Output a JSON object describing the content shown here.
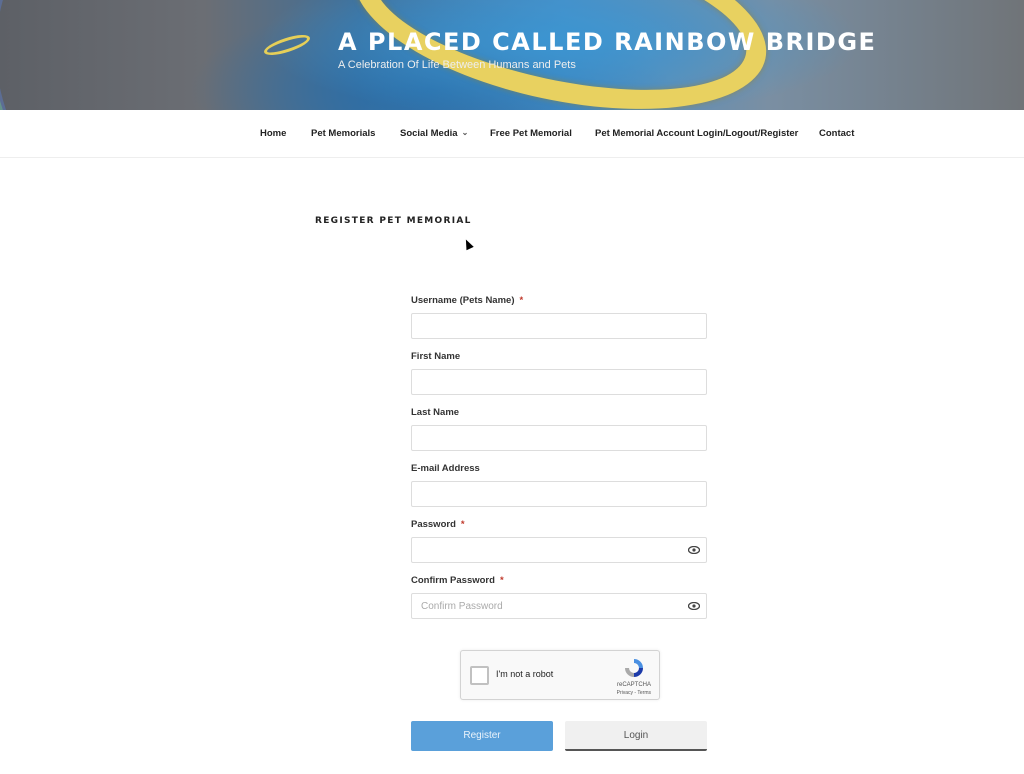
{
  "header": {
    "site_title": "A PLACED CALLED RAINBOW BRIDGE",
    "tagline": "A Celebration Of Life Between Humans and Pets"
  },
  "nav": {
    "items": [
      {
        "label": "Home"
      },
      {
        "label": "Pet Memorials"
      },
      {
        "label": "Social Media",
        "has_dropdown": true
      },
      {
        "label": "Free Pet Memorial"
      },
      {
        "label": "Pet Memorial Account Login/Logout/Register"
      },
      {
        "label": "Contact"
      }
    ]
  },
  "page": {
    "title": "REGISTER PET MEMORIAL"
  },
  "form": {
    "required_marker": "*",
    "fields": [
      {
        "label": "Username (Pets Name)",
        "required": true,
        "value": "",
        "placeholder": ""
      },
      {
        "label": "First Name",
        "required": false,
        "value": "",
        "placeholder": ""
      },
      {
        "label": "Last Name",
        "required": false,
        "value": "",
        "placeholder": ""
      },
      {
        "label": "E-mail Address",
        "required": false,
        "value": "",
        "placeholder": ""
      },
      {
        "label": "Password",
        "required": true,
        "value": "",
        "placeholder": ""
      },
      {
        "label": "Confirm Password",
        "required": true,
        "value": "",
        "placeholder": "Confirm Password"
      }
    ],
    "captcha": {
      "label": "I'm not a robot",
      "brand": "reCAPTCHA",
      "links": "Privacy - Terms"
    },
    "register_label": "Register",
    "login_label": "Login"
  },
  "colors": {
    "register_button": "#5aa0da",
    "required_star": "#c0392b"
  }
}
